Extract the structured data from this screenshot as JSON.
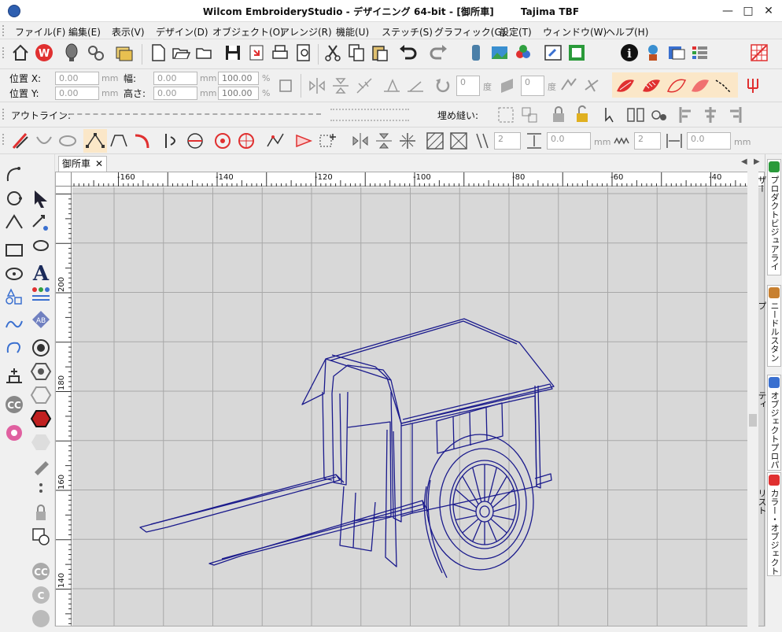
{
  "window": {
    "title_app": "Wilcom EmbroideryStudio - デザイニング 64-bit - [御所車]",
    "title_machine": "Tajima TBF",
    "controls": [
      "—",
      "□",
      "✕"
    ]
  },
  "menu": [
    "ファイル(F)",
    "編集(E)",
    "表示(V)",
    "デザイン(D)",
    "オブジェクト(O)",
    "アレンジ(R)",
    "機能(U)",
    "ステッチ(S)",
    "グラフィック(G)",
    "設定(T)",
    "ウィンドウ(W)",
    "ヘルプ(H)"
  ],
  "position": {
    "x_label": "位置 X:",
    "y_label": "位置 Y:",
    "x_value": "0.00",
    "y_value": "0.00",
    "unit": "mm"
  },
  "size": {
    "w_label": "幅:",
    "h_label": "高さ:",
    "w_value": "0.00",
    "h_value": "0.00",
    "unit": "mm",
    "w_pct": "100.00",
    "h_pct": "100.00",
    "pct_unit": "%"
  },
  "rotate": {
    "value1": "0",
    "value2": "0",
    "unit": "度"
  },
  "outline_label": "アウトライン:",
  "fill_label": "埋め縫い:",
  "stitch_params": {
    "count1": "2",
    "spacing1": "0.0",
    "unit": "mm",
    "count2": "2",
    "spacing2": "0.0"
  },
  "document_tab": {
    "name": "御所車",
    "close": "✕"
  },
  "ruler_h": [
    "-160",
    "-140",
    "-120",
    "-100",
    "-80",
    "-60",
    "-40"
  ],
  "ruler_v": [
    "200",
    "180",
    "160",
    "140"
  ],
  "right_panel": [
    "プロダクトビジュアライザー",
    "ニードルスタンプ",
    "オブジェクトプロパティ",
    "カラー・オブジェクトリスト"
  ],
  "colors": {
    "accent_red": "#e03030",
    "outline_navy": "#1a1a8c",
    "canvas_bg": "#d8d8d8",
    "grid": "#a8a8a8"
  }
}
